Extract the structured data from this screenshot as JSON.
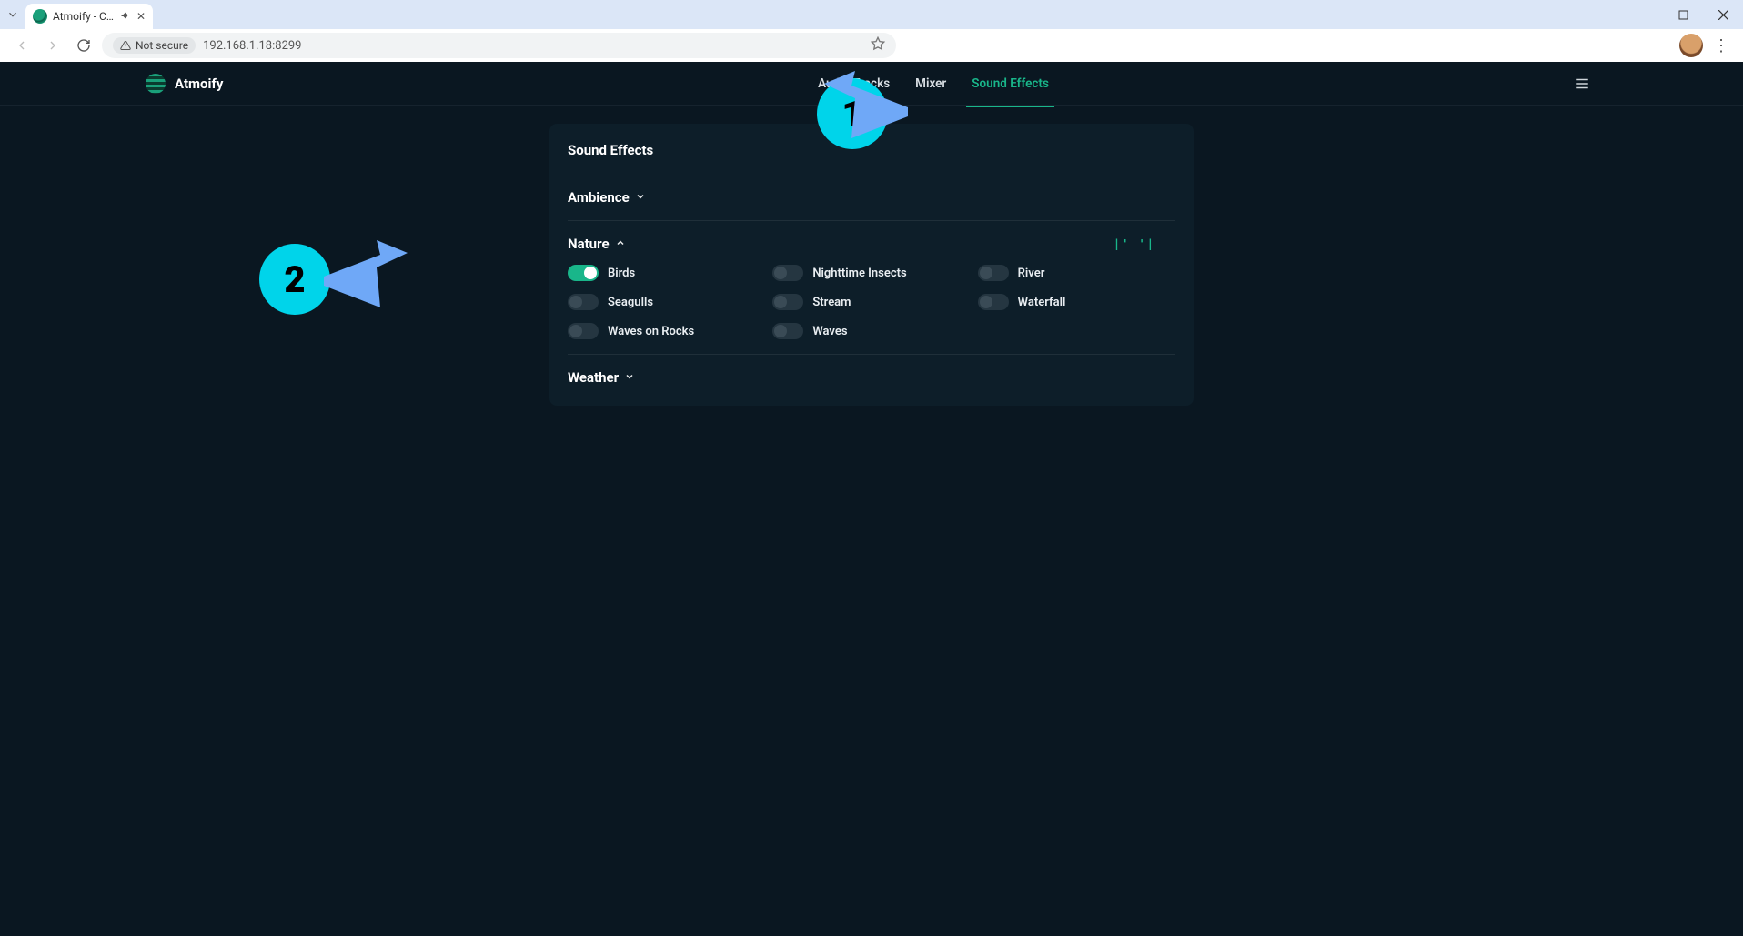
{
  "browser": {
    "tab_title": "Atmoify - Create",
    "url": "192.168.1.18:8299",
    "security_label": "Not secure"
  },
  "app": {
    "brand": "Atmoify",
    "nav": {
      "audio_tracks": "Audio Tracks",
      "mixer": "Mixer",
      "sound_effects": "Sound Effects",
      "active": "sound_effects"
    }
  },
  "panel": {
    "title": "Sound Effects",
    "sections": {
      "ambience": {
        "label": "Ambience",
        "expanded": false
      },
      "nature": {
        "label": "Nature",
        "expanded": true,
        "playing_indicator": "|' '|",
        "items": [
          {
            "key": "birds",
            "label": "Birds",
            "on": true
          },
          {
            "key": "nighttime_insects",
            "label": "Nighttime Insects",
            "on": false
          },
          {
            "key": "river",
            "label": "River",
            "on": false
          },
          {
            "key": "seagulls",
            "label": "Seagulls",
            "on": false
          },
          {
            "key": "stream",
            "label": "Stream",
            "on": false
          },
          {
            "key": "waterfall",
            "label": "Waterfall",
            "on": false
          },
          {
            "key": "waves_on_rocks",
            "label": "Waves on Rocks",
            "on": false
          },
          {
            "key": "waves",
            "label": "Waves",
            "on": false
          }
        ]
      },
      "weather": {
        "label": "Weather",
        "expanded": false
      }
    }
  },
  "annotations": {
    "c1": "1",
    "c2": "2"
  }
}
